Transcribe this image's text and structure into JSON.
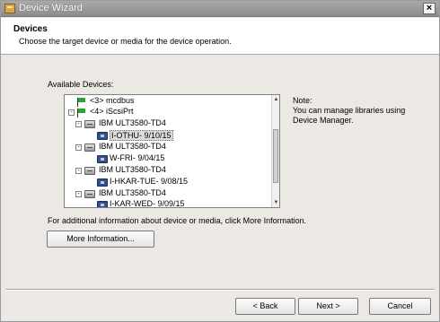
{
  "window": {
    "title": "Device Wizard",
    "close_symbol": "×"
  },
  "header": {
    "title": "Devices",
    "subtitle": "Choose the target device or media for the device operation."
  },
  "available": {
    "label": "Available Devices:",
    "tree": [
      {
        "label": "<3> mcdbus",
        "icon": "flag-icon",
        "expander": ""
      },
      {
        "label": "<4> iScsiPrt",
        "icon": "flag-icon",
        "expander": "-"
      },
      {
        "label": "IBM    ULT3580-TD4",
        "icon": "drive-icon",
        "expander": "-"
      },
      {
        "label": "I-OTHU- 9/10/15",
        "icon": "tape-icon",
        "expander": "",
        "selected": true
      },
      {
        "label": "IBM    ULT3580-TD4",
        "icon": "drive-icon",
        "expander": "-"
      },
      {
        "label": "W-FRI- 9/04/15",
        "icon": "tape-icon",
        "expander": ""
      },
      {
        "label": "IBM    ULT3580-TD4",
        "icon": "drive-icon",
        "expander": "-"
      },
      {
        "label": "I-HKAR-TUE- 9/08/15",
        "icon": "tape-icon",
        "expander": ""
      },
      {
        "label": "IBM    ULT3580-TD4",
        "icon": "drive-icon",
        "expander": "-"
      },
      {
        "label": "I-KAR-WED- 9/09/15",
        "icon": "tape-icon",
        "expander": ""
      }
    ]
  },
  "note": {
    "title": "Note:",
    "text": "You can manage libraries using Device Manager."
  },
  "info": {
    "text": "For additional information about device or media, click More Information.",
    "more_button": "More Information..."
  },
  "footer": {
    "back": "< Back",
    "next": "Next >",
    "cancel": "Cancel"
  }
}
